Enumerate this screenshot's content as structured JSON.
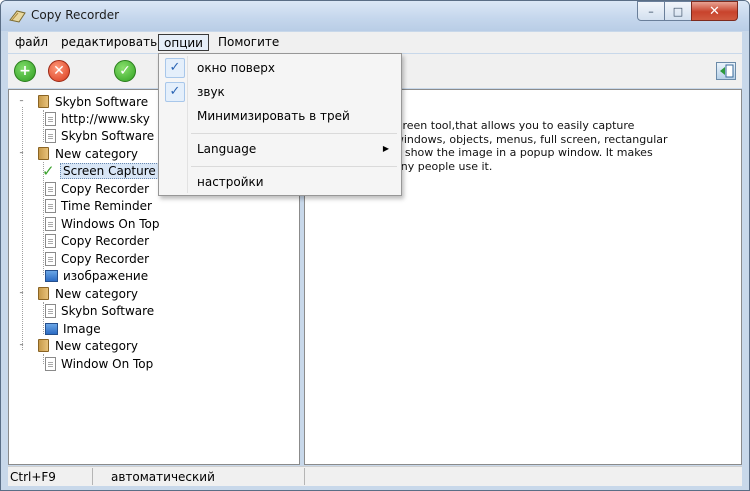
{
  "window": {
    "title": "Copy Recorder",
    "controls": {
      "minimize": "–",
      "maximize": "□",
      "close": "✕"
    }
  },
  "menubar": {
    "items": [
      "файл",
      "редактировать",
      "опции",
      "Помогите"
    ],
    "open_item": "опции"
  },
  "toolbar": {
    "icons": [
      "add-icon",
      "delete-icon",
      "ok-icon",
      "pane-toggle-icon"
    ],
    "symbols": {
      "add": "+",
      "delete": "✕",
      "ok": "✓"
    }
  },
  "options_menu": {
    "items": [
      {
        "label": "окно поверх",
        "checked": true
      },
      {
        "label": "звук",
        "checked": true
      },
      {
        "label": "Минимизировать в трей",
        "checked": false
      },
      {
        "label": "Language",
        "submenu": true
      },
      {
        "label": "настройки",
        "checked": false
      }
    ],
    "check_mark": "✓",
    "submenu_arrow": "▶"
  },
  "tree": {
    "expander": "–",
    "categories": [
      {
        "label": "Skybn Software",
        "children": [
          "http://www.sky",
          "Skybn Software"
        ]
      },
      {
        "label": "New category",
        "children": [
          "Screen Capture",
          "Copy Recorder",
          "Time Reminder",
          "Windows On Top",
          "Copy Recorder",
          "Copy Recorder",
          "изображение"
        ]
      },
      {
        "label": "New category",
        "children": [
          "Skybn Software",
          "Image"
        ]
      },
      {
        "label": "New category",
        "children": [
          "Window On Top"
        ]
      }
    ],
    "selected": "Screen Capture"
  },
  "description_lines": [
    "ture is a print screen tool,that allows you to easily capture",
    "reen including windows, objects, menus, full screen, rectangular",
    "d, file, editor, or show the image in a popup window. It makes",
    "fficiently, so many people use it."
  ],
  "statusbar": {
    "hotkey": "Ctrl+F9",
    "mode": "автоматический"
  }
}
